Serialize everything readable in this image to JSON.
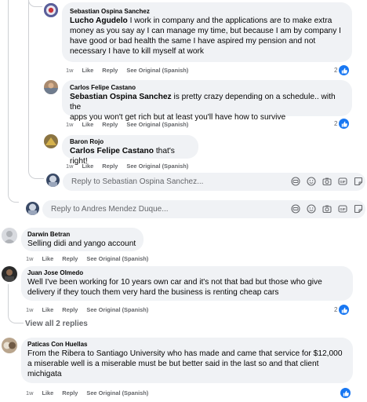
{
  "comments": [
    {
      "author": "Sebastian Ospina Sanchez",
      "mention": "Lucho Agudelo",
      "lines": [
        " I work in company and the applications are to make extra",
        "money as you say ay I can manage my time, but because I am by company I",
        "have good or bad health the same I have aspired my pension and not",
        "necessary I have to kill myself at work"
      ],
      "time": "1w",
      "reactions": "2"
    },
    {
      "author": "Carlos Felipe Castano",
      "mention": "Sebastian Ospina Sanchez",
      "lines": [
        " is pretty crazy depending on a schedule.. with the",
        "apps you won't get rich but at least you'll have how to survive"
      ],
      "time": "1w",
      "reactions": "2"
    },
    {
      "author": "Baron Rojo",
      "mention": "Carlos Felipe Castano",
      "lines": [
        " that's right!"
      ],
      "time": "1w"
    },
    {
      "author": "Darwin Betran",
      "lines": [
        "Selling didi and yango account"
      ],
      "time": "1w"
    },
    {
      "author": "Juan Jose Olmedo",
      "lines": [
        "Well I've been working for 10 years own car and it's not that bad but those who give",
        "delivery if they touch them very hard the business is renting cheap cars"
      ],
      "time": "1w",
      "reactions": "2"
    },
    {
      "author": "Paticas Con Huellas",
      "lines": [
        "From the Ribera to Santiago University who has made and came that service for $12,000",
        "a miserable well is a miserable must be but better said in the last so and that client",
        "michigata"
      ],
      "time": "1w"
    }
  ],
  "labels": {
    "like": "Like",
    "reply": "Reply",
    "see_original": "See Original (Spanish)",
    "view_replies": "View all 2 replies"
  },
  "reply_boxes": {
    "inner_placeholder": "Reply to Sebastian Ospina Sanchez...",
    "outer_placeholder": "Reply to Andres Mendez Duque..."
  },
  "colors": {
    "bubble": "#f0f2f5",
    "like_blue": "#1877f2",
    "meta_gray": "#65676b",
    "thread_line": "#ced0d4"
  },
  "icons": [
    "avatar-icon",
    "like-icon",
    "gif-icon",
    "emoji-icon",
    "camera-icon",
    "gif-badge-icon",
    "sticker-icon"
  ]
}
